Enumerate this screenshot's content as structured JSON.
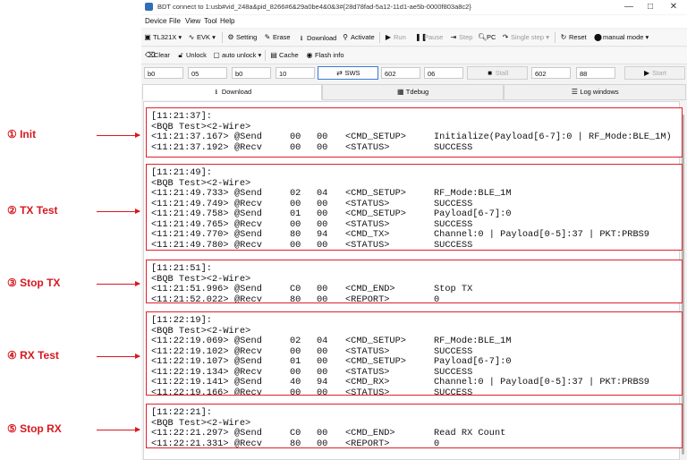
{
  "window": {
    "title": "BDT connect to 1:usb#vid_248a&pid_8266#6&29a0be4&0&3#{28d78fad-5a12-11d1-ae5b-0000f803a8c2}",
    "controls": [
      "—",
      "□",
      "✕"
    ]
  },
  "menu": [
    "Device",
    "File",
    "View",
    "Tool",
    "Help"
  ],
  "toolbar1": {
    "chip": "TL321X",
    "board": "EVK",
    "setting": "Setting",
    "erase": "Erase",
    "download": "Download",
    "activate": "Activate",
    "run": "Run",
    "pause": "Pause",
    "step": "Step",
    "pc": "PC",
    "single_step": "Single step",
    "reset": "Reset",
    "mode": "manual mode"
  },
  "toolbar2": {
    "clear": "Clear",
    "unlock": "Unlock",
    "auto_unlock": "auto unlock",
    "cache": "Cache",
    "flash_info": "Flash info"
  },
  "params": {
    "f1": "b0",
    "f2": "05",
    "f3": "b0",
    "f4": "10",
    "sws": "SWS",
    "f5": "602",
    "f6": "06",
    "stall": "Stall",
    "f7": "602",
    "f8": "88",
    "start": "Start"
  },
  "tabs": [
    "Download",
    "Tdebug",
    "Log windows"
  ],
  "steps": [
    "① Init",
    "② TX Test",
    "③ Stop TX",
    "④ RX Test",
    "⑤ Stop RX"
  ],
  "logs": [
    {
      "header": "[11:21:37]:",
      "lines": [
        {
          "text": "<BQB Test><2-Wire>"
        },
        {
          "time": "<11:21:37.167>",
          "op": "@Send",
          "a": "00",
          "b": "00",
          "cmd": "<CMD_SETUP>",
          "desc": "Initialize(Payload[6-7]:0 | RF_Mode:BLE_1M)"
        },
        {
          "time": "<11:21:37.192>",
          "op": "@Recv",
          "a": "00",
          "b": "00",
          "cmd": "<STATUS>",
          "desc": "SUCCESS"
        }
      ]
    },
    {
      "header": "[11:21:49]:",
      "lines": [
        {
          "text": "<BQB Test><2-Wire>"
        },
        {
          "time": "<11:21:49.733>",
          "op": "@Send",
          "a": "02",
          "b": "04",
          "cmd": "<CMD_SETUP>",
          "desc": "RF_Mode:BLE_1M"
        },
        {
          "time": "<11:21:49.749>",
          "op": "@Recv",
          "a": "00",
          "b": "00",
          "cmd": "<STATUS>",
          "desc": "SUCCESS"
        },
        {
          "time": "<11:21:49.758>",
          "op": "@Send",
          "a": "01",
          "b": "00",
          "cmd": "<CMD_SETUP>",
          "desc": "Payload[6-7]:0"
        },
        {
          "time": "<11:21:49.765>",
          "op": "@Recv",
          "a": "00",
          "b": "00",
          "cmd": "<STATUS>",
          "desc": "SUCCESS"
        },
        {
          "time": "<11:21:49.770>",
          "op": "@Send",
          "a": "80",
          "b": "94",
          "cmd": "<CMD_TX>",
          "desc": "Channel:0 | Payload[0-5]:37 | PKT:PRBS9"
        },
        {
          "time": "<11:21:49.780>",
          "op": "@Recv",
          "a": "00",
          "b": "00",
          "cmd": "<STATUS>",
          "desc": "SUCCESS"
        }
      ]
    },
    {
      "header": "[11:21:51]:",
      "lines": [
        {
          "text": "<BQB Test><2-Wire>"
        },
        {
          "time": "<11:21:51.996>",
          "op": "@Send",
          "a": "C0",
          "b": "00",
          "cmd": "<CMD_END>",
          "desc": "Stop TX"
        },
        {
          "time": "<11:21:52.022>",
          "op": "@Recv",
          "a": "80",
          "b": "00",
          "cmd": "<REPORT>",
          "desc": "0"
        }
      ]
    },
    {
      "header": "[11:22:19]:",
      "lines": [
        {
          "text": "<BQB Test><2-Wire>"
        },
        {
          "time": "<11:22:19.069>",
          "op": "@Send",
          "a": "02",
          "b": "04",
          "cmd": "<CMD_SETUP>",
          "desc": "RF_Mode:BLE_1M"
        },
        {
          "time": "<11:22:19.102>",
          "op": "@Recv",
          "a": "00",
          "b": "00",
          "cmd": "<STATUS>",
          "desc": "SUCCESS"
        },
        {
          "time": "<11:22:19.107>",
          "op": "@Send",
          "a": "01",
          "b": "00",
          "cmd": "<CMD_SETUP>",
          "desc": "Payload[6-7]:0"
        },
        {
          "time": "<11:22:19.134>",
          "op": "@Recv",
          "a": "00",
          "b": "00",
          "cmd": "<STATUS>",
          "desc": "SUCCESS"
        },
        {
          "time": "<11:22:19.141>",
          "op": "@Send",
          "a": "40",
          "b": "94",
          "cmd": "<CMD_RX>",
          "desc": "Channel:0 | Payload[0-5]:37 | PKT:PRBS9"
        },
        {
          "time": "<11:22:19.166>",
          "op": "@Recv",
          "a": "00",
          "b": "00",
          "cmd": "<STATUS>",
          "desc": "SUCCESS"
        }
      ]
    },
    {
      "header": "[11:22:21]:",
      "lines": [
        {
          "text": "<BQB Test><2-Wire>"
        },
        {
          "time": "<11:22:21.297>",
          "op": "@Send",
          "a": "C0",
          "b": "00",
          "cmd": "<CMD_END>",
          "desc": "Read RX Count"
        },
        {
          "time": "<11:22:21.331>",
          "op": "@Recv",
          "a": "80",
          "b": "00",
          "cmd": "<REPORT>",
          "desc": "0"
        }
      ]
    }
  ],
  "colors": {
    "annotation": "#e0202b",
    "accent": "#3a7bd5"
  }
}
